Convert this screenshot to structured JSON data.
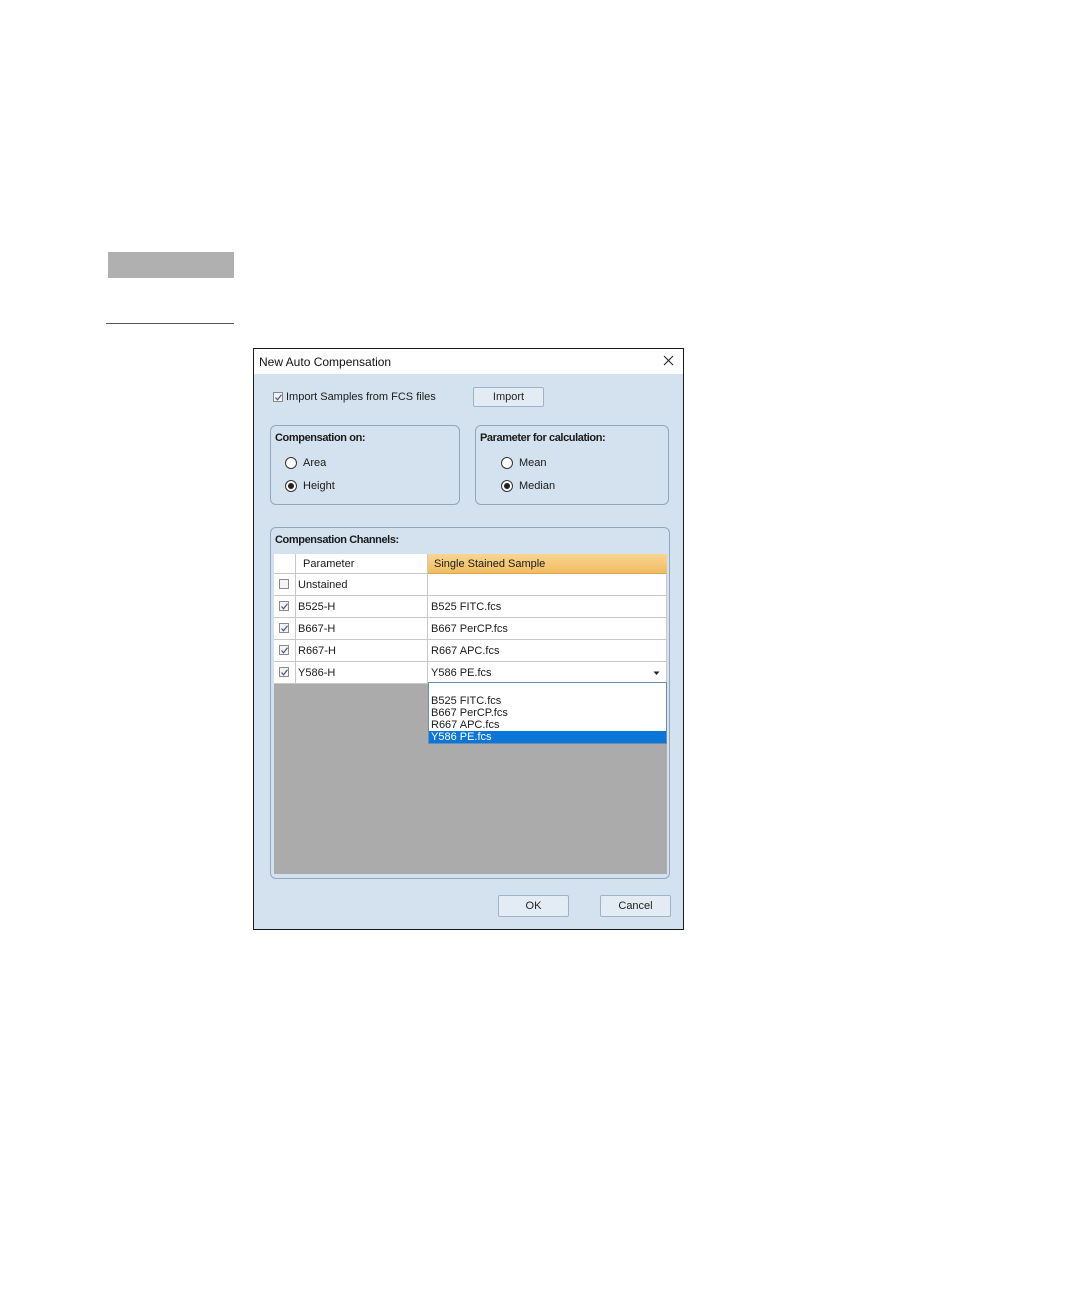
{
  "dialog": {
    "title": "New Auto Compensation",
    "close_icon": "close-icon",
    "import_checkbox_label": "Import Samples from FCS files",
    "import_checked": true,
    "import_button": "Import",
    "compensation_on": {
      "title": "Compensation on:",
      "options": [
        "Area",
        "Height"
      ],
      "selected": "Height"
    },
    "parameter_for_calculation": {
      "title": "Parameter for calculation:",
      "options": [
        "Mean",
        "Median"
      ],
      "selected": "Median"
    },
    "channels": {
      "title": "Compensation Channels:",
      "columns": [
        "Parameter",
        "Single Stained Sample"
      ],
      "rows": [
        {
          "checked": false,
          "parameter": "Unstained",
          "sample": ""
        },
        {
          "checked": true,
          "parameter": "B525-H",
          "sample": "B525 FITC.fcs"
        },
        {
          "checked": true,
          "parameter": "B667-H",
          "sample": "B667 PerCP.fcs"
        },
        {
          "checked": true,
          "parameter": "R667-H",
          "sample": "R667 APC.fcs"
        },
        {
          "checked": true,
          "parameter": "Y586-H",
          "sample": "Y586 PE.fcs"
        }
      ],
      "dropdown_options": [
        "",
        "B525 FITC.fcs",
        "B667 PerCP.fcs",
        "R667 APC.fcs",
        "Y586 PE.fcs"
      ],
      "dropdown_selected": "Y586 PE.fcs",
      "header_accent_color": "#f5c87a"
    },
    "ok_button": "OK",
    "cancel_button": "Cancel"
  }
}
